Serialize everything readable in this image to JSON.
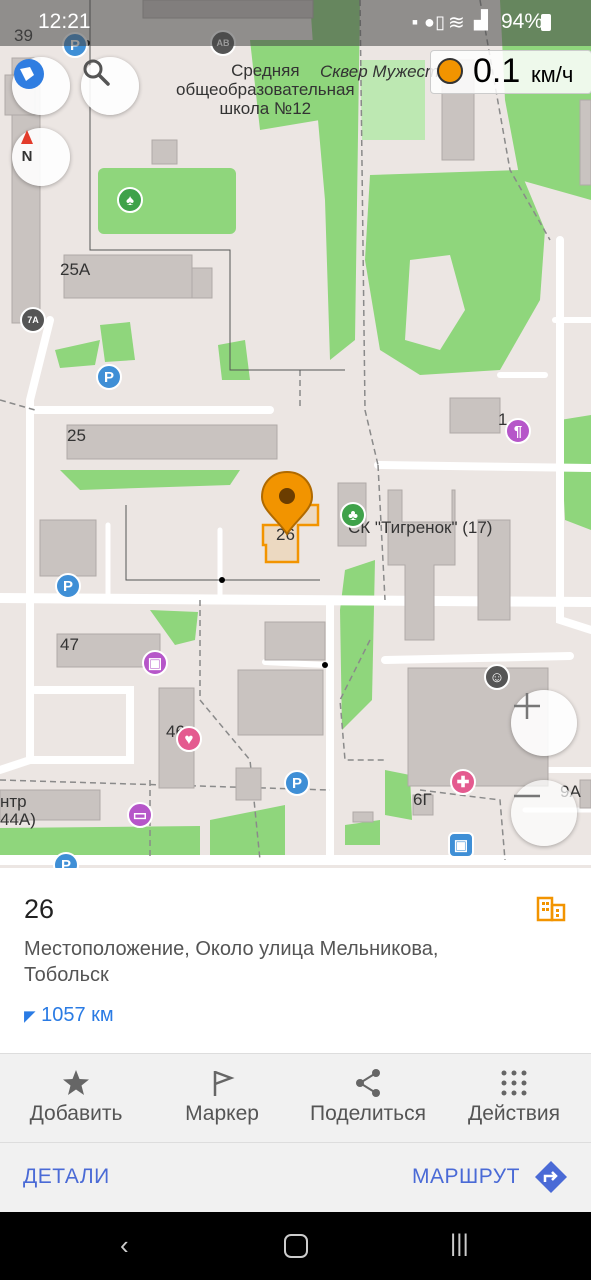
{
  "status_bar": {
    "time": "12:21",
    "battery": "94%"
  },
  "speed": {
    "value": "0.1",
    "unit": "км/ч"
  },
  "map_labels": {
    "school": "Средняя\nобщеобразовательная\nшкола №12",
    "park": "Сквер Мужест",
    "b39": "39",
    "b25a": "25А",
    "b25": "25",
    "b1": "1",
    "b26": "26",
    "sk": "СК \"Тигренок\" (17)",
    "b47": "47",
    "b46": "46",
    "b6g": "6Г",
    "b9a": "9А",
    "ntr": "нтр",
    "b44a": "44А)"
  },
  "place": {
    "title": "26",
    "address": "Местоположение, Около улица Мельникова, Тобольск",
    "distance": "1057 км"
  },
  "actions": [
    {
      "label": "Добавить",
      "icon": "star-icon"
    },
    {
      "label": "Маркер",
      "icon": "flag-icon"
    },
    {
      "label": "Поделиться",
      "icon": "share-icon"
    },
    {
      "label": "Действия",
      "icon": "dots-grid-icon"
    }
  ],
  "bottom": {
    "details": "ДЕТАЛИ",
    "route": "МАРШРУТ"
  },
  "colors": {
    "accent": "#f29400",
    "link": "#4a6ad6",
    "park": "#8fd67c",
    "building": "#c9c3c0"
  }
}
